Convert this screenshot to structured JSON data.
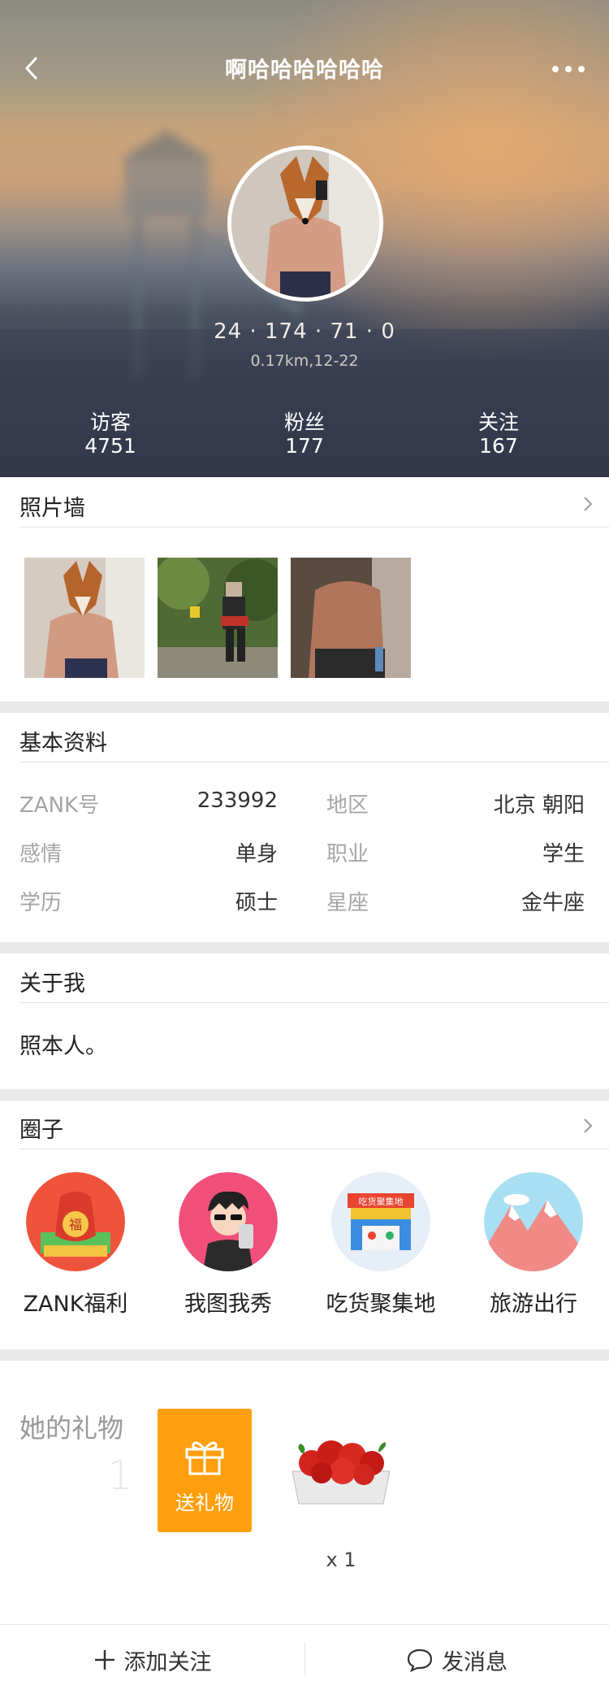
{
  "header": {
    "title": "啊哈哈哈哈哈哈",
    "stats": "24 · 174 · 71 · 0",
    "distance": "0.17km,12-22"
  },
  "counts": [
    {
      "label": "访客",
      "value": "4751"
    },
    {
      "label": "粉丝",
      "value": "177"
    },
    {
      "label": "关注",
      "value": "167"
    }
  ],
  "photo_wall": {
    "title": "照片墙"
  },
  "basic_info": {
    "title": "基本资料",
    "rows": [
      {
        "k1": "ZANK号",
        "v1": "233992",
        "k2": "地区",
        "v2": "北京 朝阳"
      },
      {
        "k1": "感情",
        "v1": "单身",
        "k2": "职业",
        "v2": "学生"
      },
      {
        "k1": "学历",
        "v1": "硕士",
        "k2": "星座",
        "v2": "金牛座"
      }
    ]
  },
  "about": {
    "title": "关于我",
    "text": "照本人。"
  },
  "circles": {
    "title": "圈子",
    "items": [
      {
        "name": "ZANK福利"
      },
      {
        "name": "我图我秀"
      },
      {
        "name": "吃货聚集地"
      },
      {
        "name": "旅游出行"
      }
    ]
  },
  "gifts": {
    "title": "她的礼物",
    "count": "1",
    "send_label": "送礼物",
    "qty": "x 1"
  },
  "bottom": {
    "follow_label": "添加关注",
    "message_label": "发消息"
  },
  "colors": {
    "accent_orange": "#ff9f0f",
    "divider": "#e9e9e9"
  }
}
